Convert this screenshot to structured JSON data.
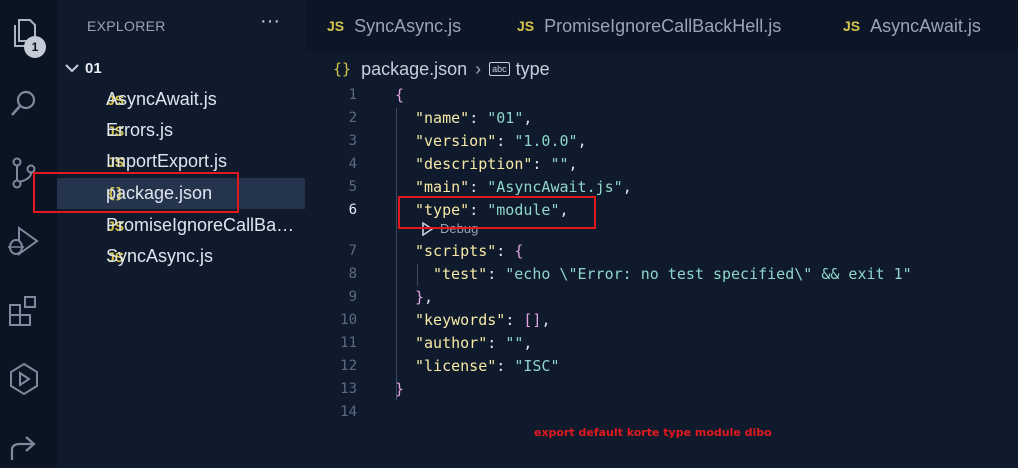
{
  "activity_bar": {
    "explorer_badge": "1"
  },
  "explorer": {
    "title": "EXPLORER",
    "more": "···",
    "folder": "01",
    "files": [
      {
        "icon": "JS",
        "name": "AsyncAwait.js"
      },
      {
        "icon": "JS",
        "name": "Errors.js"
      },
      {
        "icon": "JS",
        "name": "ImportExport.js"
      },
      {
        "icon": "{}",
        "name": "package.json"
      },
      {
        "icon": "JS",
        "name": "PromiseIgnoreCallBackHell.js"
      },
      {
        "icon": "JS",
        "name": "SyncAsync.js"
      }
    ]
  },
  "tabs": [
    {
      "icon": "JS",
      "label": "SyncAsync.js"
    },
    {
      "icon": "JS",
      "label": "PromiseIgnoreCallBackHell.js"
    },
    {
      "icon": "JS",
      "label": "AsyncAwait.js"
    }
  ],
  "breadcrumb": {
    "file_icon": "{}",
    "file": "package.json",
    "separator": "›",
    "symbol_icon": "abc",
    "symbol": "type"
  },
  "editor": {
    "line_numbers": [
      "1",
      "2",
      "3",
      "4",
      "5",
      "6",
      "7",
      "8",
      "9",
      "10",
      "11",
      "12",
      "13",
      "14"
    ],
    "codelens": "Debug",
    "lines": {
      "l1": "{",
      "l2k": "\"name\"",
      "l2v": "\"01\"",
      "l3k": "\"version\"",
      "l3v": "\"1.0.0\"",
      "l4k": "\"description\"",
      "l4v": "\"\"",
      "l5k": "\"main\"",
      "l5v": "\"AsyncAwait.js\"",
      "l6k": "\"type\"",
      "l6v": "\"module\"",
      "l7k": "\"scripts\"",
      "l7v": "{",
      "l8k": "\"test\"",
      "l8v": "\"echo \\\"Error: no test specified\\\" && exit 1\"",
      "l9": "}",
      "l10k": "\"keywords\"",
      "l10v": "[]",
      "l11k": "\"author\"",
      "l11v": "\"\"",
      "l12k": "\"license\"",
      "l12v": "\"ISC\"",
      "l13": "}"
    }
  },
  "annotation": {
    "note": "export default korte type module dibo",
    "color": "#e3191f"
  }
}
